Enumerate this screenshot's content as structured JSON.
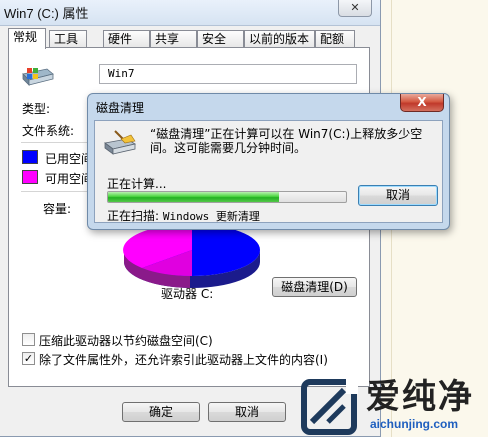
{
  "window": {
    "title": "Win7 (C:) 属性",
    "close_glyph": "✕"
  },
  "tabs": [
    "常规",
    "工具",
    "硬件",
    "共享",
    "安全",
    "以前的版本",
    "配额"
  ],
  "general": {
    "drive_name": "Win7",
    "type_label": "类型:",
    "fs_label": "文件系统:",
    "used_label": "已用空间",
    "free_label": "可用空间",
    "capacity_label": "容量:",
    "drive_label": "驱动器 C:",
    "cleanup_button": "磁盘清理(D)",
    "compress_option": "压缩此驱动器以节约磁盘空间(C)",
    "index_option": "除了文件属性外，还允许索引此驱动器上文件的内容(I)",
    "index_checked": "✓",
    "used_color": "#0000ff",
    "free_color": "#ff00ff"
  },
  "footer": {
    "ok": "确定",
    "cancel": "取消"
  },
  "dialog": {
    "title": "磁盘清理",
    "close_glyph": "X",
    "message": "“磁盘清理”正在计算可以在 Win7(C:)上释放多少空间。这可能需要几分钟时间。",
    "status": "正在计算...",
    "progress": 0.72,
    "scan_label": "正在扫描:",
    "scan_item": "Windows 更新清理",
    "cancel_button": "取消"
  },
  "watermark": {
    "brand": "爱纯净",
    "url": "aichunjing.com"
  }
}
